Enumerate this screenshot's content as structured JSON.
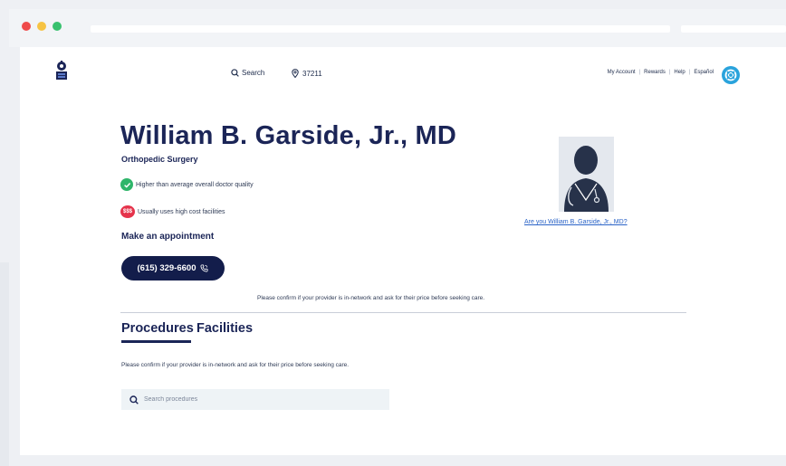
{
  "header": {
    "search_label": "Search",
    "zip": "37211",
    "links": [
      "My Account",
      "Rewards",
      "Help",
      "Español"
    ],
    "separator": "|"
  },
  "doctor": {
    "name": "William B. Garside, Jr., MD",
    "specialty": "Orthopedic Surgery",
    "quality_text": "Higher than average overall doctor quality",
    "cost_badge": "$$$",
    "cost_text": "Usually uses high cost facilities",
    "appointment_heading": "Make an appointment",
    "phone": "(615) 329-6600",
    "claim_link": "Are you William B. Garside, Jr., MD?"
  },
  "notice": {
    "confirm_top": "Please confirm if your provider is in-network and ask for their price before seeking care.",
    "confirm_tab": "Please confirm if your provider is in-network and ask for their price before seeking care."
  },
  "tabs": [
    {
      "label": "Procedures",
      "active": true
    },
    {
      "label": "Facilities",
      "active": false
    }
  ],
  "procedure_search": {
    "placeholder": "Search procedures"
  },
  "colors": {
    "brand_navy": "#1b2557",
    "quality_green": "#2fb56a",
    "cost_red": "#e5334b",
    "help_blue": "#2aa3dc",
    "link_blue": "#2a63c7"
  },
  "icons": [
    "search-icon",
    "location-pin-icon",
    "phone-icon",
    "check-icon",
    "help-icon"
  ]
}
